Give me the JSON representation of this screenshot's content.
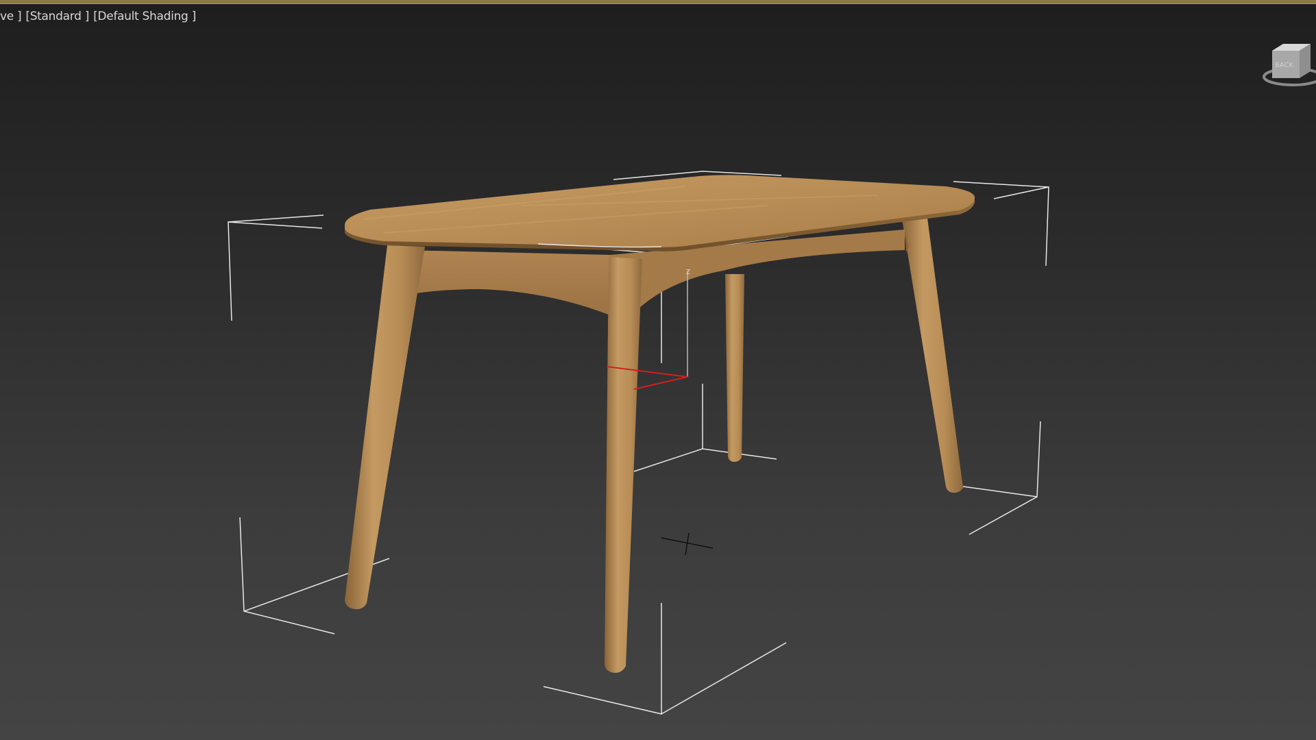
{
  "viewport": {
    "labels": [
      "ve ]",
      "[Standard ]",
      "[Default Shading ]"
    ],
    "background_top": "#1e1e1e",
    "background_bottom": "#444444",
    "frame_color": "#8a7a45"
  },
  "object": {
    "name": "table",
    "wood_color": "#c49a63",
    "bounding_box_color": "#e8e8e8"
  },
  "gizmo": {
    "axes": [
      "x",
      "y",
      "z"
    ],
    "x_color": "#d02020",
    "z_color": "#b8b8b8",
    "z_label": "z"
  },
  "viewcube": {
    "face_label": "BACK"
  }
}
